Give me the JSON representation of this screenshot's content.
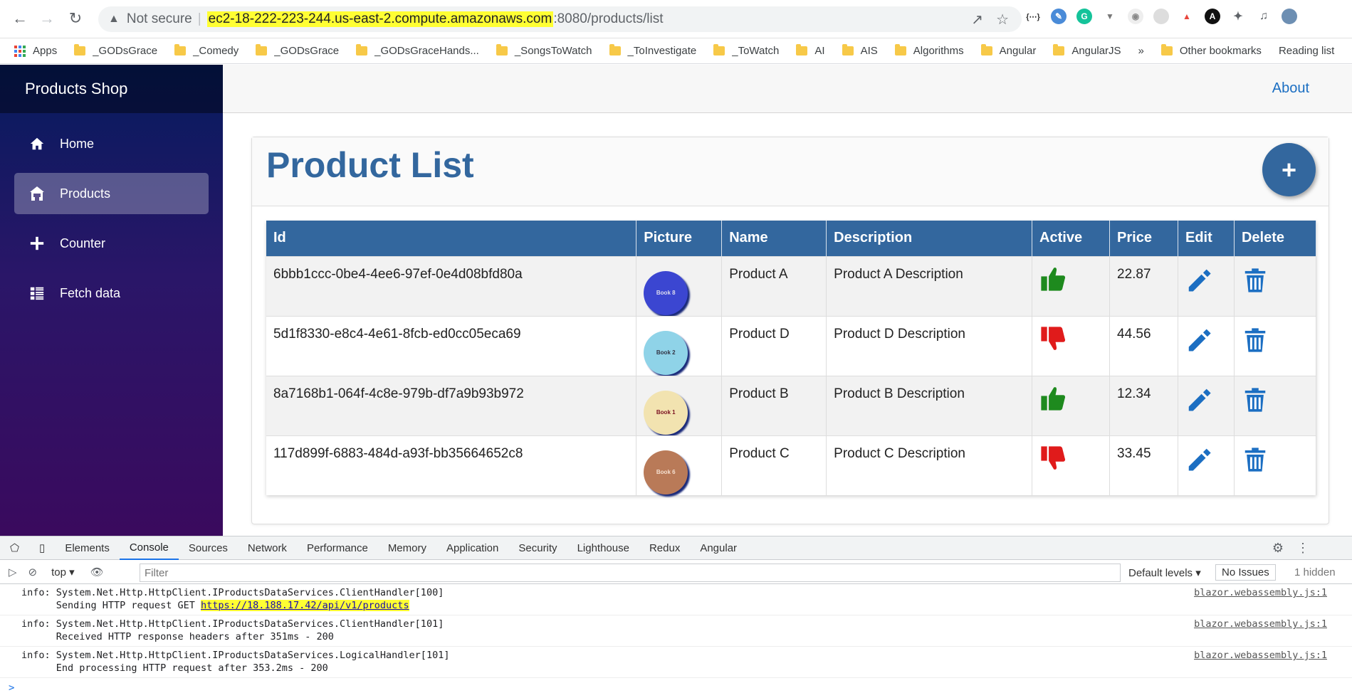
{
  "browser": {
    "security_label": "Not secure",
    "url_host": "ec2-18-222-223-244.us-east-2.compute.amazonaws.com",
    "url_path": ":8080/products/list",
    "bookmarks": [
      "Apps",
      "_GODsGrace",
      "_Comedy",
      "_GODsGrace",
      "_GODsGraceHands...",
      "_SongsToWatch",
      "_ToInvestigate",
      "_ToWatch",
      "AI",
      "AIS",
      "Algorithms",
      "Angular",
      "AngularJS"
    ],
    "bookmarks_more": "»",
    "other_bookmarks": "Other bookmarks",
    "reading_list": "Reading list"
  },
  "sidebar": {
    "brand": "Products Shop",
    "items": [
      {
        "label": "Home",
        "icon": "home-icon"
      },
      {
        "label": "Products",
        "icon": "store-icon",
        "active": true
      },
      {
        "label": "Counter",
        "icon": "plus-icon"
      },
      {
        "label": "Fetch data",
        "icon": "list-icon"
      }
    ]
  },
  "topbar": {
    "about": "About"
  },
  "main": {
    "title": "Product List",
    "add_button": "+",
    "columns": [
      "Id",
      "Picture",
      "Name",
      "Description",
      "Active",
      "Price",
      "Edit",
      "Delete"
    ],
    "rows": [
      {
        "id": "6bbb1ccc-0be4-4ee6-97ef-0e4d08bfd80a",
        "picture_label": "Book 8",
        "picture_color": "#3b46d1",
        "picture_text_color": "#dde",
        "name": "Product A",
        "description": "Product A Description",
        "active": true,
        "price": "22.87"
      },
      {
        "id": "5d1f8330-e8c4-4e61-8fcb-ed0cc05eca69",
        "picture_label": "Book 2",
        "picture_color": "#8fd3e8",
        "picture_text_color": "#334",
        "name": "Product D",
        "description": "Product D Description",
        "active": false,
        "price": "44.56"
      },
      {
        "id": "8a7168b1-064f-4c8e-979b-df7a9b93b972",
        "picture_label": "Book 1",
        "picture_color": "#f2e3b0",
        "picture_text_color": "#7a1020",
        "name": "Product B",
        "description": "Product B Description",
        "active": true,
        "price": "12.34"
      },
      {
        "id": "117d899f-6883-484d-a93f-bb35664652c8",
        "picture_label": "Book 6",
        "picture_color": "#b97a58",
        "picture_text_color": "#f5e0d0",
        "name": "Product C",
        "description": "Product C Description",
        "active": false,
        "price": "33.45"
      }
    ]
  },
  "colors": {
    "accent": "#33679e",
    "link": "#1b6ec2",
    "active_up": "#1e8a1e",
    "active_down": "#e01b1b"
  },
  "devtools": {
    "tabs": [
      "Elements",
      "Console",
      "Sources",
      "Network",
      "Performance",
      "Memory",
      "Application",
      "Security",
      "Lighthouse",
      "Redux",
      "Angular"
    ],
    "active_tab": "Console",
    "context": "top",
    "filter_placeholder": "Filter",
    "levels": "Default levels",
    "issues": "No Issues",
    "hidden": "1 hidden",
    "logs": [
      {
        "line1": "info: System.Net.Http.HttpClient.IProductsDataServices.ClientHandler[100]",
        "line2_prefix": "      Sending HTTP request GET ",
        "line2_link": "https://18.188.17.42/api/v1/products",
        "source": "blazor.webassembly.js:1"
      },
      {
        "line1": "info: System.Net.Http.HttpClient.IProductsDataServices.ClientHandler[101]",
        "line2_prefix": "      Received HTTP response headers after 351ms - 200",
        "line2_link": "",
        "source": "blazor.webassembly.js:1"
      },
      {
        "line1": "info: System.Net.Http.HttpClient.IProductsDataServices.LogicalHandler[101]",
        "line2_prefix": "      End processing HTTP request after 353.2ms - 200",
        "line2_link": "",
        "source": "blazor.webassembly.js:1"
      }
    ],
    "prompt": ">"
  }
}
